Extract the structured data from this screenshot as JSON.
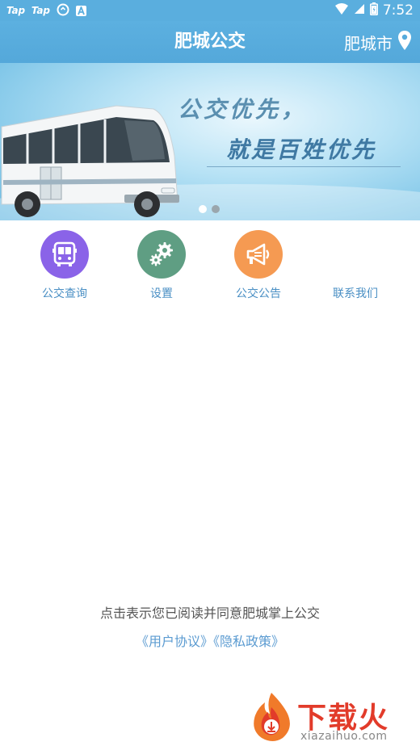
{
  "status_bar": {
    "apps": [
      "Tap",
      "Tap"
    ],
    "time": "7:52"
  },
  "header": {
    "title": "肥城公交",
    "city": "肥城市",
    "location_icon": "location-pin-icon"
  },
  "banner": {
    "line1": "公交优先，",
    "line2": "就是百姓优先",
    "slide_count": 2,
    "active_slide": 0
  },
  "menu": [
    {
      "label": "公交查询",
      "icon": "bus-icon",
      "color": "#8a63e8"
    },
    {
      "label": "设置",
      "icon": "gears-icon",
      "color": "#5f9e83"
    },
    {
      "label": "公交公告",
      "icon": "megaphone-icon",
      "color": "#f59a52"
    },
    {
      "label": "联系我们",
      "icon": "",
      "color": ""
    }
  ],
  "agreement": {
    "text": "点击表示您已阅读并同意肥城掌上公交",
    "user_agreement": "《用户协议》",
    "privacy_policy": "《隐私政策》"
  },
  "watermark": {
    "brand": "下载火",
    "url": "xiazaihuo.com"
  },
  "colors": {
    "header": "#56abdc",
    "menu_label": "#4a8fc4",
    "link": "#5b9bd1"
  }
}
